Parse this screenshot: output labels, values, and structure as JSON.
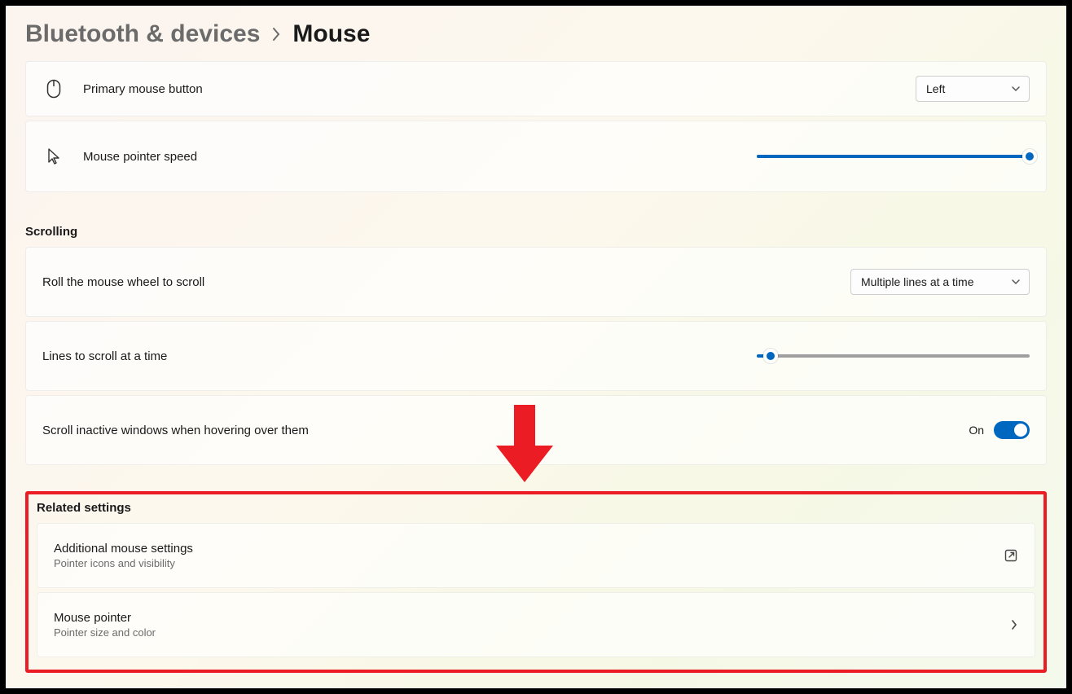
{
  "breadcrumb": {
    "parent": "Bluetooth & devices",
    "current": "Mouse"
  },
  "primary_button": {
    "label": "Primary mouse button",
    "value": "Left"
  },
  "pointer_speed": {
    "label": "Mouse pointer speed",
    "percent": 100
  },
  "sections": {
    "scrolling": "Scrolling",
    "related": "Related settings"
  },
  "wheel_scroll": {
    "label": "Roll the mouse wheel to scroll",
    "value": "Multiple lines at a time"
  },
  "lines_scroll": {
    "label": "Lines to scroll at a time",
    "percent": 5
  },
  "inactive_scroll": {
    "label": "Scroll inactive windows when hovering over them",
    "state": "On"
  },
  "related": {
    "additional": {
      "title": "Additional mouse settings",
      "sub": "Pointer icons and visibility"
    },
    "pointer": {
      "title": "Mouse pointer",
      "sub": "Pointer size and color"
    }
  }
}
